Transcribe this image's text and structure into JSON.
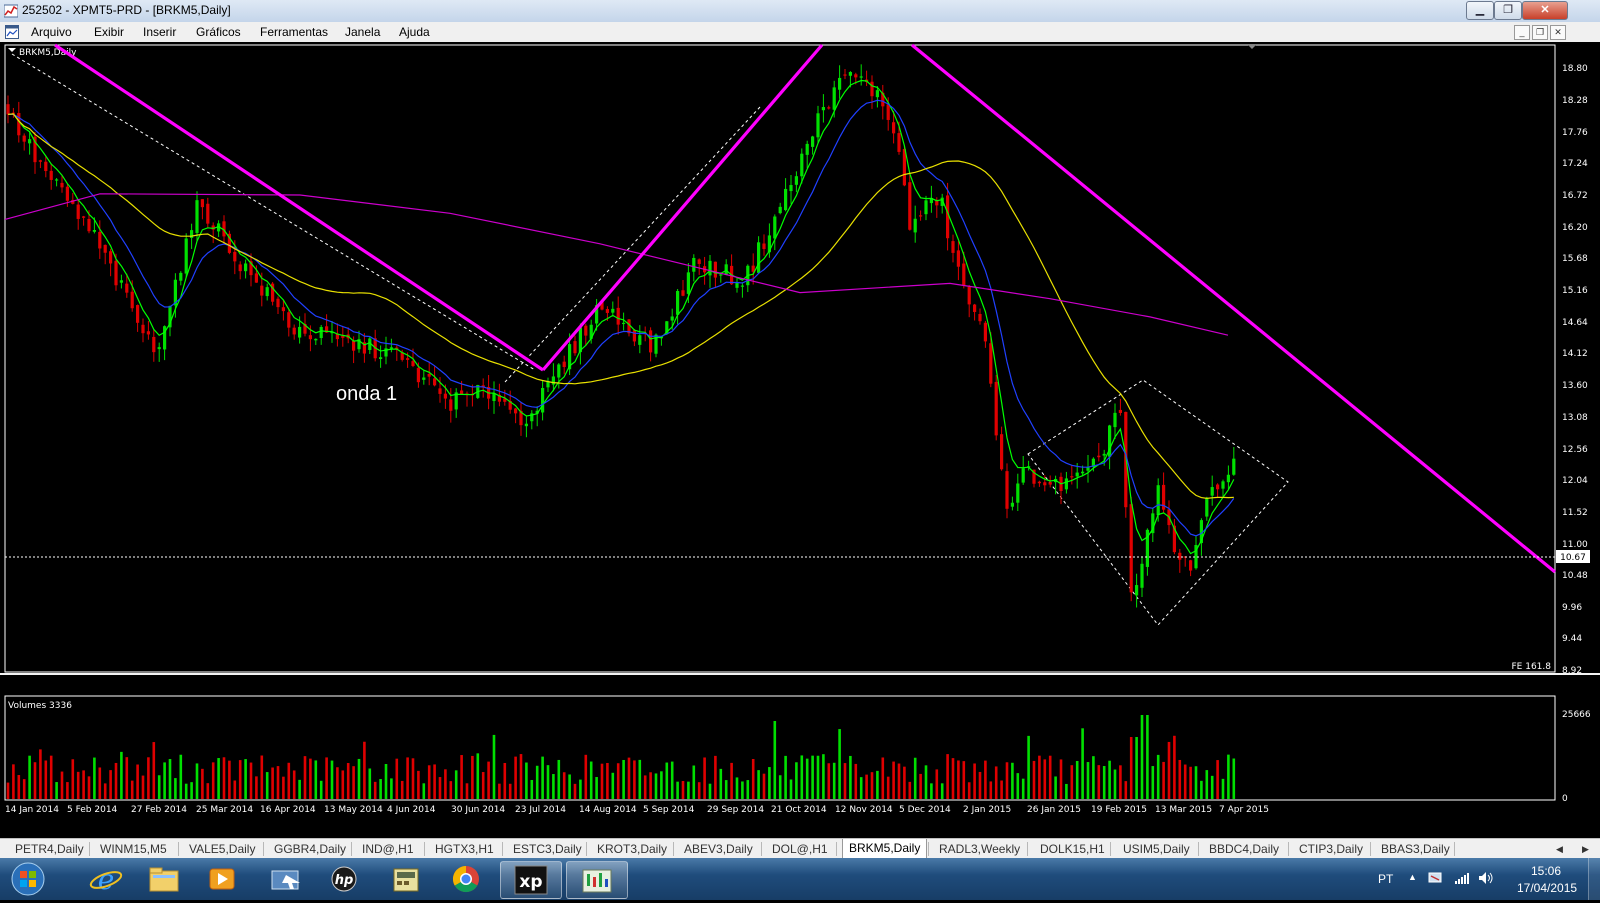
{
  "window": {
    "title": "252502 - XPMT5-PRD - [BRKM5,Daily]"
  },
  "menu": {
    "items": [
      "Arquivo",
      "Exibir",
      "Inserir",
      "Gráficos",
      "Ferramentas",
      "Janela",
      "Ajuda"
    ]
  },
  "chart": {
    "symbol_label": "BRKM5,Daily",
    "price_axis": [
      "18.80",
      "18.28",
      "17.76",
      "17.24",
      "16.72",
      "16.20",
      "15.68",
      "15.16",
      "14.64",
      "14.12",
      "13.60",
      "13.08",
      "12.56",
      "12.04",
      "11.52",
      "11.00",
      "10.48",
      "9.96",
      "9.44",
      "8.92"
    ],
    "current_price": "10.67",
    "fe_label": "FE 161.8",
    "annotation": "onda 1",
    "volume_label": "Volumes 3336",
    "volume_axis": [
      "25666",
      "0"
    ],
    "date_axis": [
      "14 Jan 2014",
      "5 Feb 2014",
      "27 Feb 2014",
      "25 Mar 2014",
      "16 Apr 2014",
      "13 May 2014",
      "4 Jun 2014",
      "30 Jun 2014",
      "23 Jul 2014",
      "14 Aug 2014",
      "5 Sep 2014",
      "29 Sep 2014",
      "21 Oct 2014",
      "12 Nov 2014",
      "5 Dec 2014",
      "2 Jan 2015",
      "26 Jan 2015",
      "19 Feb 2015",
      "13 Mar 2015",
      "7 Apr 2015"
    ],
    "colors": {
      "bull": "#00e000",
      "bear": "#e00000",
      "ma_green": "#00ff00",
      "ma_blue": "#2040ff",
      "ma_yellow": "#e8e000",
      "ma_magenta": "#cc00cc",
      "trend": "#ff00ff"
    }
  },
  "tabs": [
    "PETR4,Daily",
    "WINM15,M5",
    "VALE5,Daily",
    "GGBR4,Daily",
    "IND@,H1",
    "HGTX3,H1",
    "ESTC3,Daily",
    "KROT3,Daily",
    "ABEV3,Daily",
    "DOL@,H1",
    "BRKM5,Daily",
    "RADL3,Weekly",
    "DOLK15,H1",
    "USIM5,Daily",
    "BBDC4,Daily",
    "CTIP3,Daily",
    "BBAS3,Daily"
  ],
  "active_tab": "BRKM5,Daily",
  "taskbar": {
    "lang": "PT",
    "time": "15:06",
    "date": "17/04/2015"
  }
}
